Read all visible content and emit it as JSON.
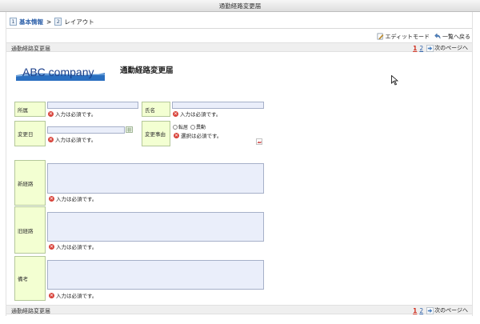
{
  "window": {
    "title": "通勤経路変更届"
  },
  "breadcrumb": {
    "steps": [
      {
        "num": "1",
        "label": "基本情報"
      },
      {
        "num": "2",
        "label": "レイアウト"
      }
    ],
    "separator": ">"
  },
  "toolbar": {
    "edit_mode": "エディットモード",
    "back_to_list": "一覧へ戻る"
  },
  "pagebar": {
    "title": "通勤経路変更届",
    "page1": "1",
    "page2": "2",
    "next": "次のページへ"
  },
  "form": {
    "logo_text": "ABC company",
    "title": "通勤経路変更届",
    "fields": {
      "department": {
        "label": "所属",
        "error": "入力は必須です。"
      },
      "name": {
        "label": "氏名",
        "error": "入力は必須です。"
      },
      "change_date": {
        "label": "変更日",
        "error": "入力は必須です。"
      },
      "change_reason": {
        "label": "変更事由",
        "options": [
          "転居",
          "異動"
        ],
        "error": "選択は必須です。"
      },
      "new_route": {
        "label": "新経路",
        "error": "入力は必須です。"
      },
      "old_route": {
        "label": "旧経路",
        "error": "入力は必須です。"
      },
      "remarks": {
        "label": "備考",
        "error": "入力は必須です。"
      }
    }
  },
  "colors": {
    "label_bg": "#f3ffd2",
    "field_bg": "#eaeefa",
    "error": "#d8433a",
    "link": "#2a5ea8"
  }
}
